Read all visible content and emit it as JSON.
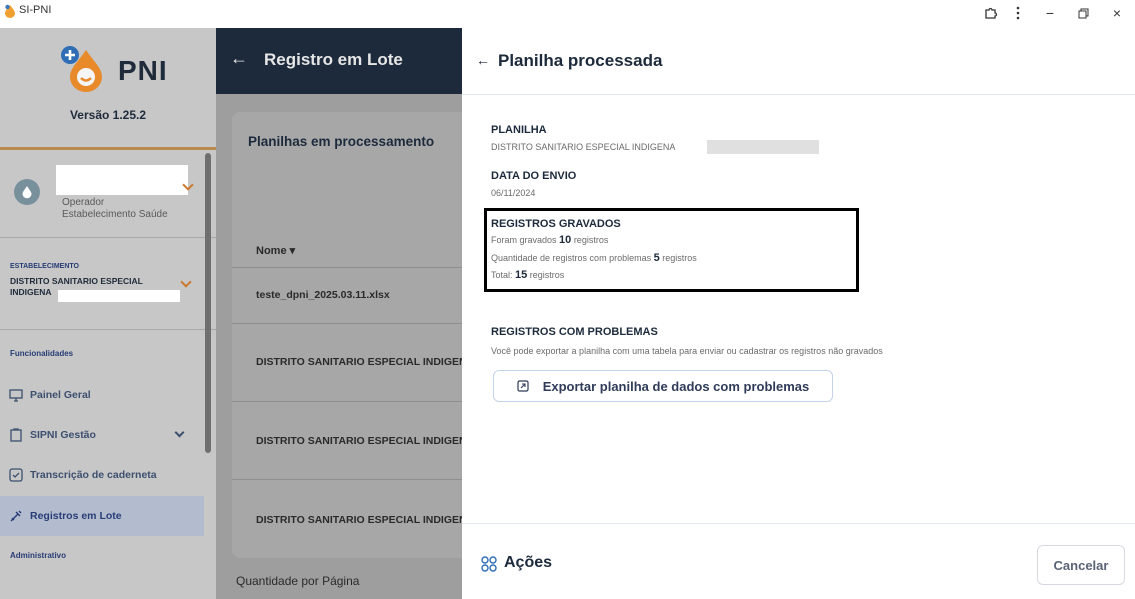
{
  "window": {
    "title": "SI-PNI",
    "controls": {
      "extension_icon": "puzzle-icon",
      "menu_icon": "kebab-menu-icon",
      "minimize": "−",
      "restore": "restore-icon",
      "close": "×"
    }
  },
  "sidebar": {
    "logo_text": "PNI",
    "version": "Versão 1.25.2",
    "user": {
      "role_line1": "Operador",
      "role_line2": "Estabelecimento Saúde"
    },
    "establishment": {
      "label": "ESTABELECIMENTO",
      "value_line1": "DISTRITO SANITARIO ESPECIAL",
      "value_line2": "INDIGENA"
    },
    "section_functionalities": "Funcionalidades",
    "section_admin": "Administrativo",
    "items": [
      {
        "label": "Painel Geral",
        "icon": "monitor-icon"
      },
      {
        "label": "SIPNI Gestão",
        "icon": "clipboard-icon"
      },
      {
        "label": "Transcrição de caderneta",
        "icon": "checkbox-icon"
      },
      {
        "label": "Registros em Lote",
        "icon": "syringe-icon"
      }
    ]
  },
  "middle": {
    "header_title": "Registro em Lote",
    "card_title": "Planilhas em processamento",
    "column_name": "Nome",
    "rows": [
      "teste_dpni_2025.03.11.xlsx",
      "DISTRITO SANITARIO ESPECIAL INDIGENA",
      "DISTRITO SANITARIO ESPECIAL INDIGENA",
      "DISTRITO SANITARIO ESPECIAL INDIGENA"
    ],
    "per_page_label": "Quantidade por Página"
  },
  "panel": {
    "title": "Planilha processada",
    "planilha_label": "PLANILHA",
    "planilha_value": "DISTRITO SANITARIO ESPECIAL INDIGENA",
    "envio_label": "DATA DO ENVIO",
    "envio_value": "06/11/2024",
    "gravados": {
      "label": "REGISTROS GRAVADOS",
      "line1_prefix": "Foram gravados",
      "line1_count": "10",
      "line1_suffix": "registros",
      "line2_prefix": "Quantidade de registros com problemas",
      "line2_count": "5",
      "line2_suffix": "registros",
      "line3_prefix": "Total:",
      "line3_count": "15",
      "line3_suffix": "registros"
    },
    "problemas": {
      "label": "REGISTROS COM PROBLEMAS",
      "description": "Você pode exportar a planilha com uma tabela para enviar ou cadastrar os registros não gravados",
      "export_button": "Exportar planilha de dados com problemas"
    },
    "footer": {
      "acoes_label": "Ações",
      "cancel_button": "Cancelar"
    }
  }
}
